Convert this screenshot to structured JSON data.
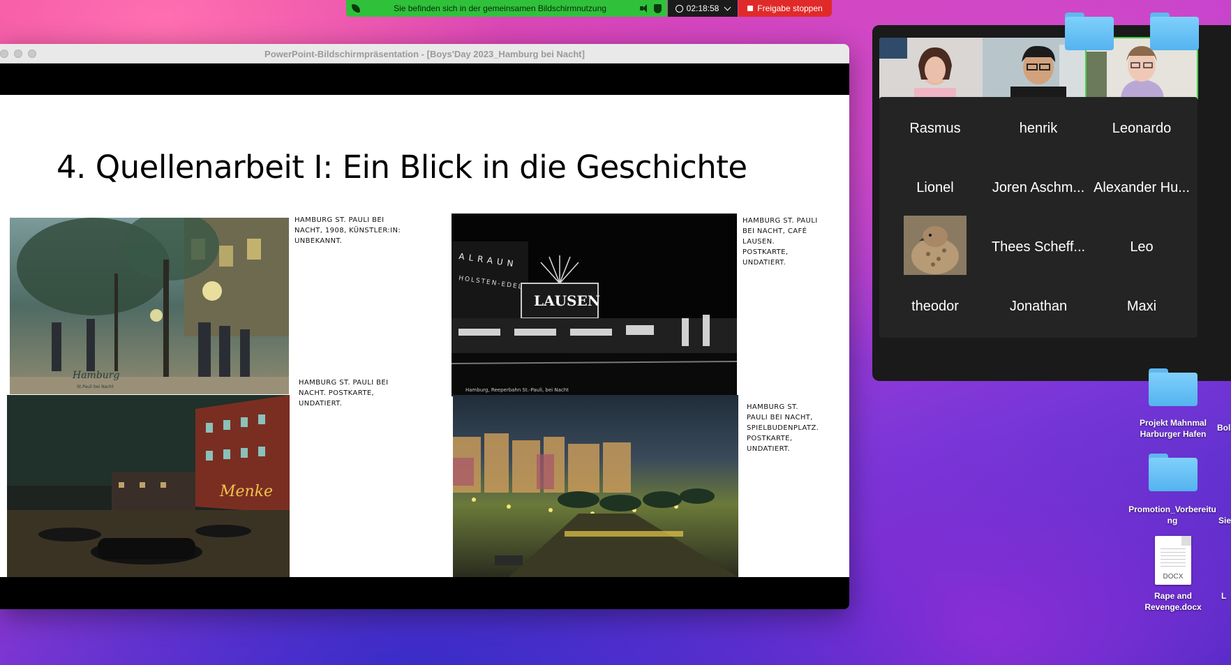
{
  "share_bar": {
    "message": "Sie befinden sich in der gemeinsamen Bildschirmnutzung",
    "timer": "02:18:58",
    "stop_label": "Freigabe stoppen"
  },
  "ppt": {
    "window_title": "PowerPoint-Bildschirmpräsentation - [Boys'Day 2023_Hamburg bei Nacht]",
    "slide_title": "4. Quellenarbeit I: Ein Blick in die Geschichte",
    "captions": [
      "Hamburg St. Pauli bei Nacht, 1908, Künstler:in: unbekannt.",
      "Hamburg St. Pauli bei Nacht. Postkarte, undatiert.",
      "Hamburg St. Pauli bei Nacht, Café Lausen. Postkarte, undatiert.",
      "Hamburg St. Pauli bei Nacht, Spielbudenplatz. Postkarte, undatiert."
    ],
    "photo_texts": {
      "p1_script": "Hamburg",
      "p1_sub": "St.Pauli bei Nacht",
      "p2_sign": "Menke",
      "p3_alraun": "ALRAUN",
      "p3_holsten": "HOLSTEN-EDEL",
      "p3_lausen": "LAUSEN",
      "p3_caption": "Hamburg, Reeperbahn  St.-Pauli, bei Nacht"
    }
  },
  "gallery": {
    "names": [
      "Rasmus",
      "henrik",
      "Leonardo",
      "Lionel",
      "Joren Aschm...",
      "Alexander Hu...",
      "Thees Scheff...",
      "Leo",
      "theodor",
      "Jonathan",
      "Maxi"
    ]
  },
  "desktop": {
    "items": [
      "Projekt Mahnmal Harburger Hafen",
      "Promotion_Vorbereitung",
      "Rape and Revenge.docx"
    ],
    "doc_ext": "DOCX",
    "edge_fragments": [
      "Bol",
      "Sie",
      "L"
    ]
  },
  "colors": {
    "share_green": "#30c13b",
    "stop_red": "#e02a2a",
    "active_speaker": "#46d146",
    "folder_blue": "#5fb8f0"
  }
}
